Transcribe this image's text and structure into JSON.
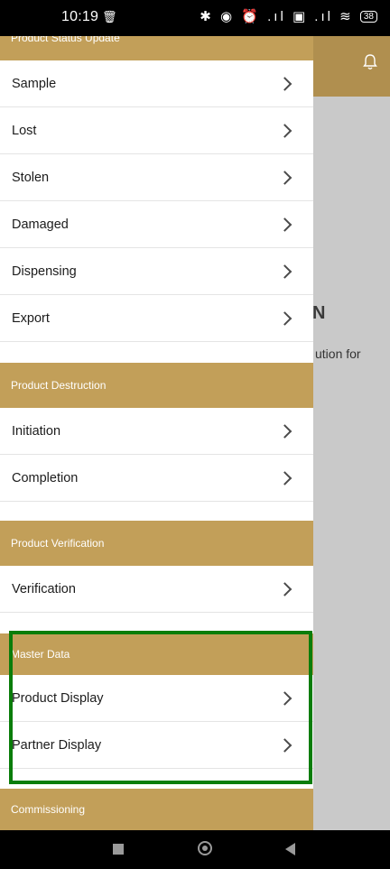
{
  "status_bar": {
    "time": "10:19",
    "trash_icon": "trash-icon",
    "icons": "✱ ◉ ⏰ .ıl ▣ .ıl ≋",
    "battery": "38"
  },
  "background": {
    "header_color": "#b08f4f",
    "bell_icon": "bell-icon",
    "heading_fragment": "N",
    "text_fragment": "ution for"
  },
  "drawer": {
    "top_header": "Product Status Update",
    "status_items": [
      "Sample",
      "Lost",
      "Stolen",
      "Damaged",
      "Dispensing",
      "Export"
    ],
    "destruction": {
      "header": "Product Destruction",
      "items": [
        "Initiation",
        "Completion"
      ]
    },
    "verification": {
      "header": "Product Verification",
      "items": [
        "Verification"
      ]
    },
    "master_data": {
      "header": "Master Data",
      "items": [
        "Product Display",
        "Partner Display"
      ]
    },
    "commissioning": {
      "header": "Commissioning"
    },
    "accent_color": "#c29f59",
    "highlight_color": "#0a7d0a"
  }
}
